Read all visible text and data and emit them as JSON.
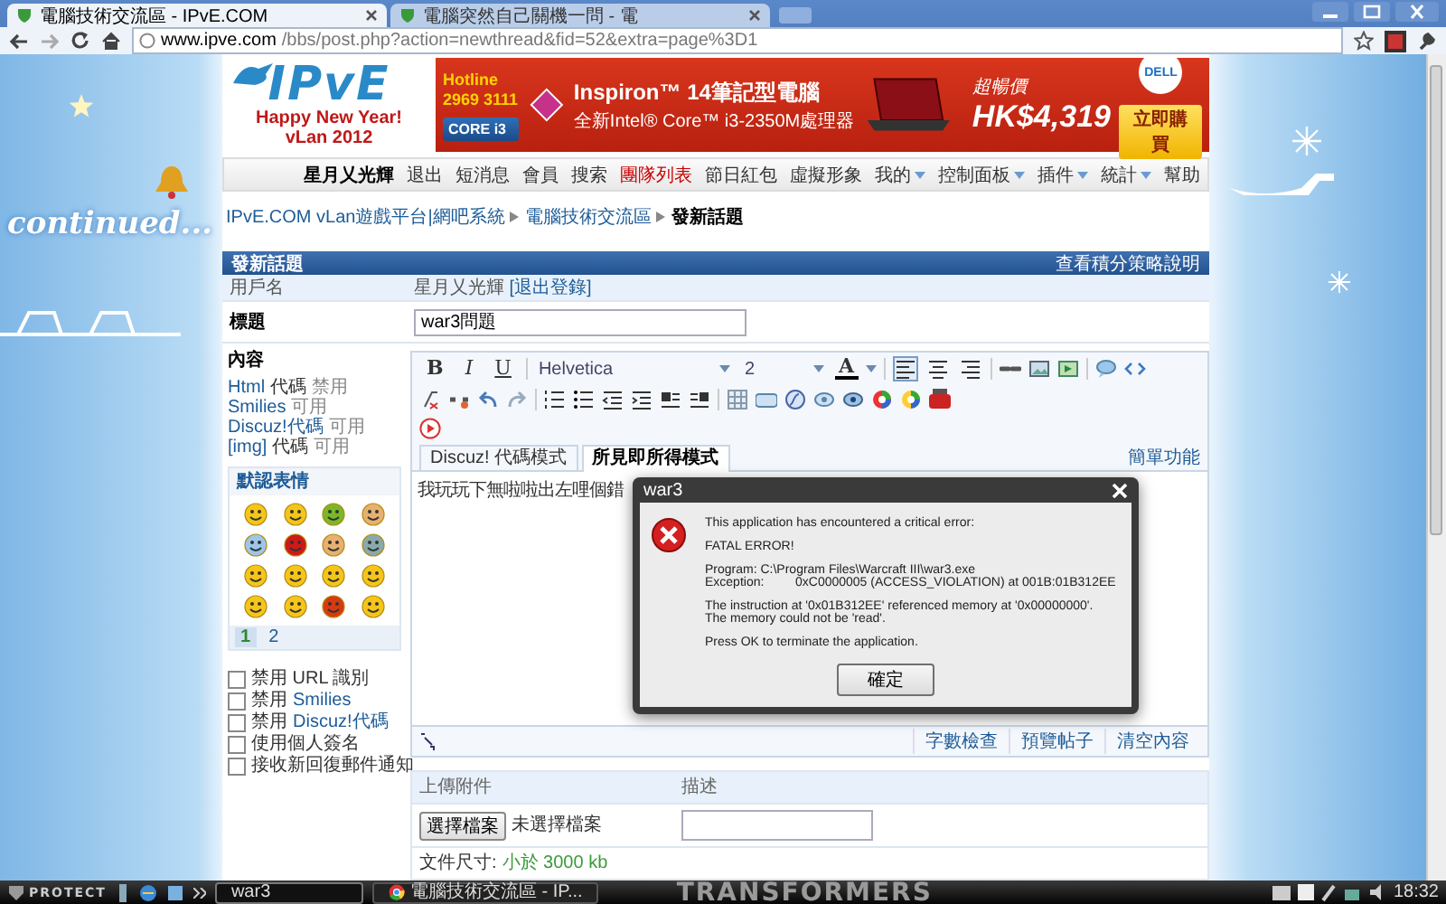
{
  "browser": {
    "tabs": [
      {
        "title": "電腦技術交流區 - IPvE.COM",
        "selected": true
      },
      {
        "title": "電腦突然自己關機一問 - 電",
        "selected": false
      }
    ],
    "url_host": "www.ipve.com",
    "url_path": "/bbs/post.php?action=newthread&fid=52&extra=page%3D1"
  },
  "background": {
    "text": "continued..."
  },
  "banner": {
    "logo_text": "IPvE",
    "logo_lines": [
      "Happy New Year!",
      "vLan 2012"
    ],
    "ad": {
      "hotline_label": "Hotline",
      "hotline": "2969 3111",
      "chip_label": "CORE i3",
      "title": "Inspiron™ 14筆記型電腦",
      "subtitle": "全新Intel® Core™ i3-2350M處理器",
      "price_label": "超暢價",
      "price": "HK$4,319",
      "button": "立即購買",
      "brand": "DELL"
    }
  },
  "nav": [
    {
      "label": "星月乂光輝",
      "kind": "user"
    },
    {
      "label": "退出",
      "kind": "link"
    },
    {
      "label": "短消息",
      "kind": "link"
    },
    {
      "label": "會員",
      "kind": "link"
    },
    {
      "label": "搜索",
      "kind": "link"
    },
    {
      "label": "團隊列表",
      "kind": "highlight"
    },
    {
      "label": "節日紅包",
      "kind": "link"
    },
    {
      "label": "虛擬形象",
      "kind": "link"
    },
    {
      "label": "我的",
      "kind": "menu"
    },
    {
      "label": "控制面板",
      "kind": "menu"
    },
    {
      "label": "插件",
      "kind": "menu"
    },
    {
      "label": "統計",
      "kind": "menu"
    },
    {
      "label": "幫助",
      "kind": "link"
    }
  ],
  "breadcrumb": [
    "IPvE.COM vLan遊戲平台|網吧系統",
    "電腦技術交流區",
    "發新話題"
  ],
  "panel": {
    "title": "發新話題",
    "help_link": "查看積分策略說明"
  },
  "username": {
    "label": "用戶名",
    "value": "星月乂光輝",
    "logout": "[退出登錄]"
  },
  "subject": {
    "label": "標題",
    "value": "war3問題"
  },
  "content": {
    "label": "內容",
    "codes": [
      {
        "name": "Html",
        "suffix": "代碼",
        "status": "禁用"
      },
      {
        "name": "Smilies",
        "status": "可用"
      },
      {
        "name": "Discuz!代碼",
        "status": "可用"
      },
      {
        "name": "[img]",
        "suffix": "代碼",
        "status": "可用"
      }
    ]
  },
  "smilies": {
    "title": "默認表情",
    "pages": [
      {
        "label": "1",
        "selected": true
      },
      {
        "label": "2",
        "selected": false
      }
    ]
  },
  "options": [
    {
      "text": "禁用 URL 識別",
      "checked": false
    },
    {
      "text": "禁用",
      "link": "Smilies",
      "checked": false
    },
    {
      "text": "禁用",
      "link": "Discuz!代碼",
      "checked": false
    },
    {
      "text": "使用個人簽名",
      "checked": false
    },
    {
      "text": "接收新回復郵件通知",
      "checked": false
    }
  ],
  "editor": {
    "format_buttons": [
      "B",
      "I",
      "U"
    ],
    "font": "Helvetica",
    "size": "2",
    "color_button": "A",
    "alignments": [
      {
        "selected": true
      },
      {
        "selected": false
      },
      {
        "selected": false
      }
    ],
    "modes": [
      {
        "label": "Discuz! 代碼模式",
        "selected": false
      },
      {
        "label": "所見即所得模式",
        "selected": true
      }
    ],
    "simple_link": "簡單功能",
    "body": "我玩玩下無啦啦出左哩個錯",
    "footer_links": [
      "字數檢查",
      "預覽帖子",
      "清空內容"
    ]
  },
  "attachments": {
    "columns": [
      "上傳附件",
      "描述"
    ],
    "choose_button": "選擇檔案",
    "no_file": "未選擇檔案",
    "size_label": "文件尺寸:",
    "size_value": "小於 3000 kb"
  },
  "dialog": {
    "title": "war3",
    "paragraphs": [
      [
        {
          "kind": "text",
          "text": "This application has encountered a critical error:"
        }
      ],
      [
        {
          "kind": "text",
          "text": "FATAL ERROR!"
        }
      ],
      [
        {
          "kind": "text",
          "text": "Program: C:\\Program Files\\Warcraft III\\war3.exe"
        },
        {
          "kind": "field",
          "label": "Exception:",
          "value": "0xC0000005 (ACCESS_VIOLATION) at 001B:01B312EE"
        }
      ],
      [
        {
          "kind": "text",
          "text": "The instruction at '0x01B312EE' referenced memory at '0x00000000'."
        },
        {
          "kind": "text",
          "text": "The memory could not be 'read'."
        }
      ],
      [
        {
          "kind": "text",
          "text": "Press OK to terminate the application."
        }
      ]
    ],
    "button": "確定"
  },
  "taskbar": {
    "start": "PROTECT",
    "windows": [
      {
        "title": "war3",
        "selected": true
      },
      {
        "title": "電腦技術交流區 - IP...",
        "selected": false
      }
    ],
    "wallpaper_text": "TRANSFORMERS",
    "clock": "18:32"
  }
}
